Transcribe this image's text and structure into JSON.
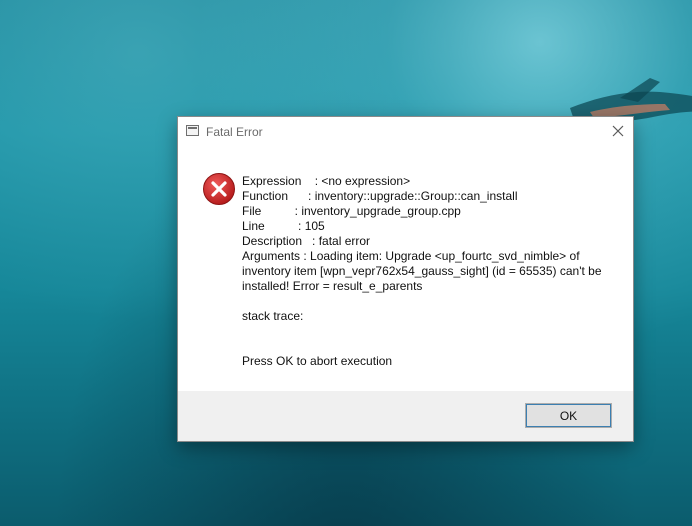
{
  "dialog": {
    "title": "Fatal Error",
    "lines": [
      "Expression    : <no expression>",
      "Function      : inventory::upgrade::Group::can_install",
      "File          : inventory_upgrade_group.cpp",
      "Line          : 105",
      "Description   : fatal error"
    ],
    "arguments": "Arguments     : Loading item: Upgrade <up_fourtc_svd_nimble> of inventory item [wpn_vepr762x54_gauss_sight] (id = 65535) can't be installed! Error = result_e_parents",
    "stack_trace": "stack trace:",
    "prompt": "Press OK to abort execution",
    "ok_label": "OK"
  },
  "icons": {
    "app": "app-window-icon",
    "close": "close-icon",
    "error": "error-icon"
  },
  "colors": {
    "error_red": "#d62b2b",
    "button_focus": "#3c7fb1",
    "footer_bg": "#f0f0f0"
  }
}
